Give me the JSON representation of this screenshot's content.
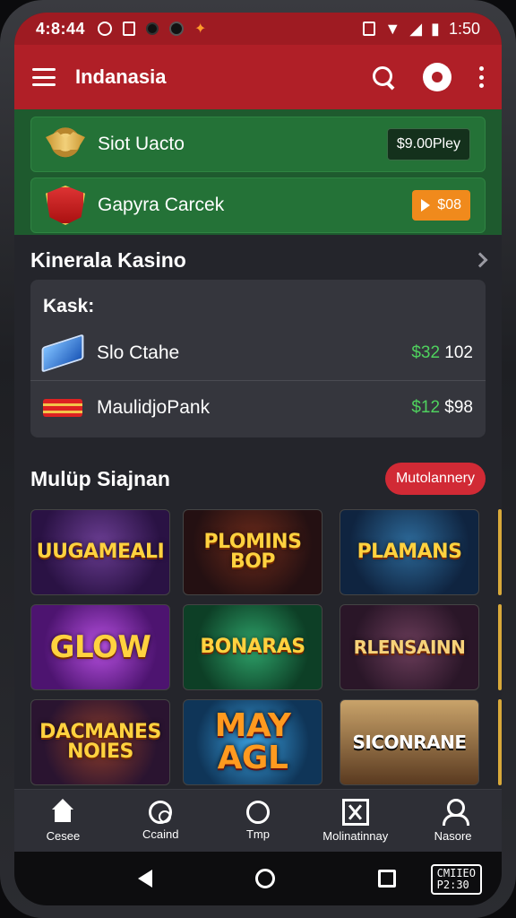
{
  "status_bar": {
    "time": "4:8:44",
    "right_text": "1:50"
  },
  "app_bar": {
    "title": "Indanasia"
  },
  "promos": [
    {
      "label": "Siot Uacto",
      "button": "$9.00Pley"
    },
    {
      "label": "Gapyra Carcek",
      "button": "$08"
    }
  ],
  "section1": {
    "title": "Kinerala Kasino",
    "card_title": "Kask:",
    "rows": [
      {
        "label": "Slo Ctahe",
        "currency": "$32",
        "amount": "102"
      },
      {
        "label": "MaulidjoPank",
        "currency": "$12",
        "amount": "$98"
      }
    ]
  },
  "section2": {
    "title": "Mulüp Siajnan",
    "pill": "Mutolannery",
    "games": [
      "UUGAMEALI",
      "PLOMINS BOP",
      "PLAMANS",
      "GLOW",
      "BONARAS",
      "RLENSAINN",
      "DACMANES NOIES",
      "MAY AGL",
      "SICONRANE"
    ]
  },
  "bottom_nav": [
    {
      "label": "Cesee",
      "icon": "home-icon"
    },
    {
      "label": "Ccaind",
      "icon": "chip-icon"
    },
    {
      "label": "Tmp",
      "icon": "circle-icon"
    },
    {
      "label": "Molinatinnay",
      "icon": "box-icon"
    },
    {
      "label": "Nasore",
      "icon": "user-icon"
    }
  ],
  "system_nav": {
    "badge_line1": "CMIIEO",
    "badge_line2": "P2:30"
  },
  "colors": {
    "header_red": "#b01f27",
    "promo_green": "#247237",
    "amount_green": "#4fd15e",
    "pill_red": "#d12a35",
    "promo_orange": "#f08a1c"
  }
}
